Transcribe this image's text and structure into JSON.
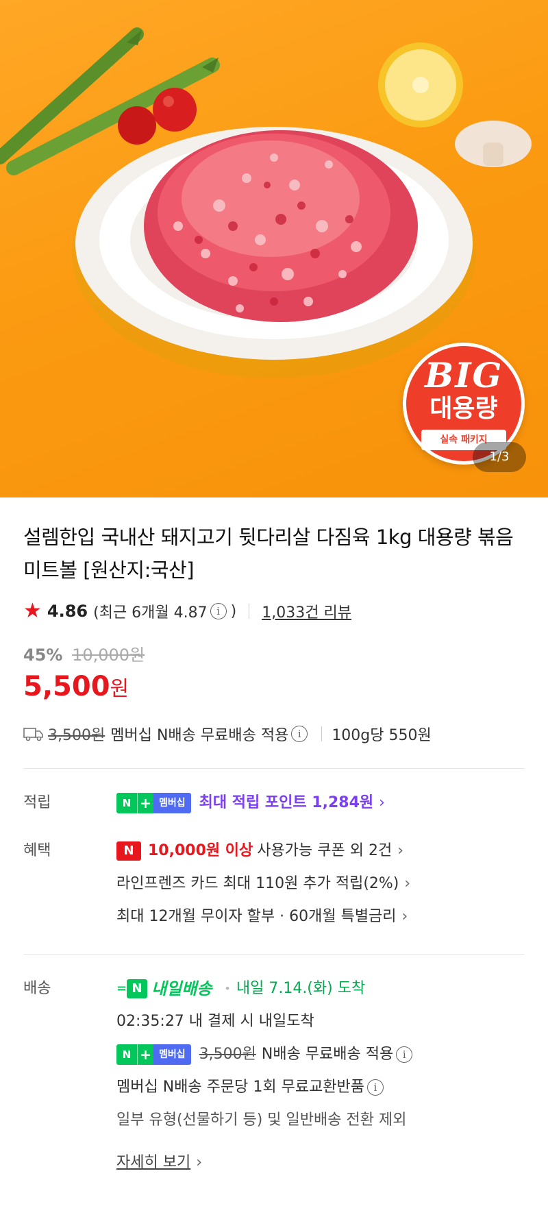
{
  "hero": {
    "badge_top": "BIG",
    "badge_main": "대용량",
    "badge_sub": "실속 패키지",
    "page_indicator": "1/3"
  },
  "product": {
    "title": "설렘한입 국내산 돼지고기 뒷다리살 다짐육 1kg 대용량 볶음 미트볼 [원산지:국산]",
    "rating": "4.86",
    "recent_rating": "(최근 6개월 4.87",
    "recent_rating_close": ")",
    "review_link": "1,033건 리뷰",
    "discount_pct": "45%",
    "original_price": "10,000원",
    "price": "5,500",
    "price_unit": "원",
    "shipping_fee_strike": "3,500원",
    "shipping_text": "멤버십 N배송 무료배송 적용",
    "unit_price": "100g당 550원"
  },
  "details": {
    "points": {
      "label": "적립",
      "badge_n": "N",
      "badge_plus": "+",
      "badge_member": "멤버십",
      "text": "최대 적립 포인트 1,284원"
    },
    "benefits": {
      "label": "혜택",
      "coupon_badge": "N",
      "coupon_highlight": "10,000원 이상",
      "coupon_text": "사용가능 쿠폰 외 2건",
      "card_text": "라인프렌즈 카드 최대 110원 추가 적립(2%)",
      "installment_text": "최대 12개월 무이자 할부 · 60개월 특별금리"
    },
    "delivery": {
      "label": "배송",
      "logo_n": "N",
      "logo_text": "내일배송",
      "arrival": "내일 7.14.(화) 도착",
      "countdown": "02:35:27 내 결제 시 내일도착",
      "badge_n": "N",
      "badge_plus": "+",
      "badge_member": "멤버십",
      "free_ship_strike": "3,500원",
      "free_ship_text": "N배송 무료배송 적용",
      "exchange_text": "멤버십 N배송 주문당 1회 무료교환반품",
      "exclusion_text": "일부 유형(선물하기 등) 및 일반배송 전환 제외",
      "more_link": "자세히 보기"
    }
  },
  "colors": {
    "accent_red": "#e8161d",
    "naver_green": "#03c75a",
    "membership_blue": "#4e6bf2",
    "points_purple": "#7b3ff2",
    "hero_orange": "#fb9b12"
  },
  "icons": [
    "star-icon",
    "info-icon",
    "truck-icon",
    "chevron-right-icon",
    "naver-n-icon"
  ]
}
